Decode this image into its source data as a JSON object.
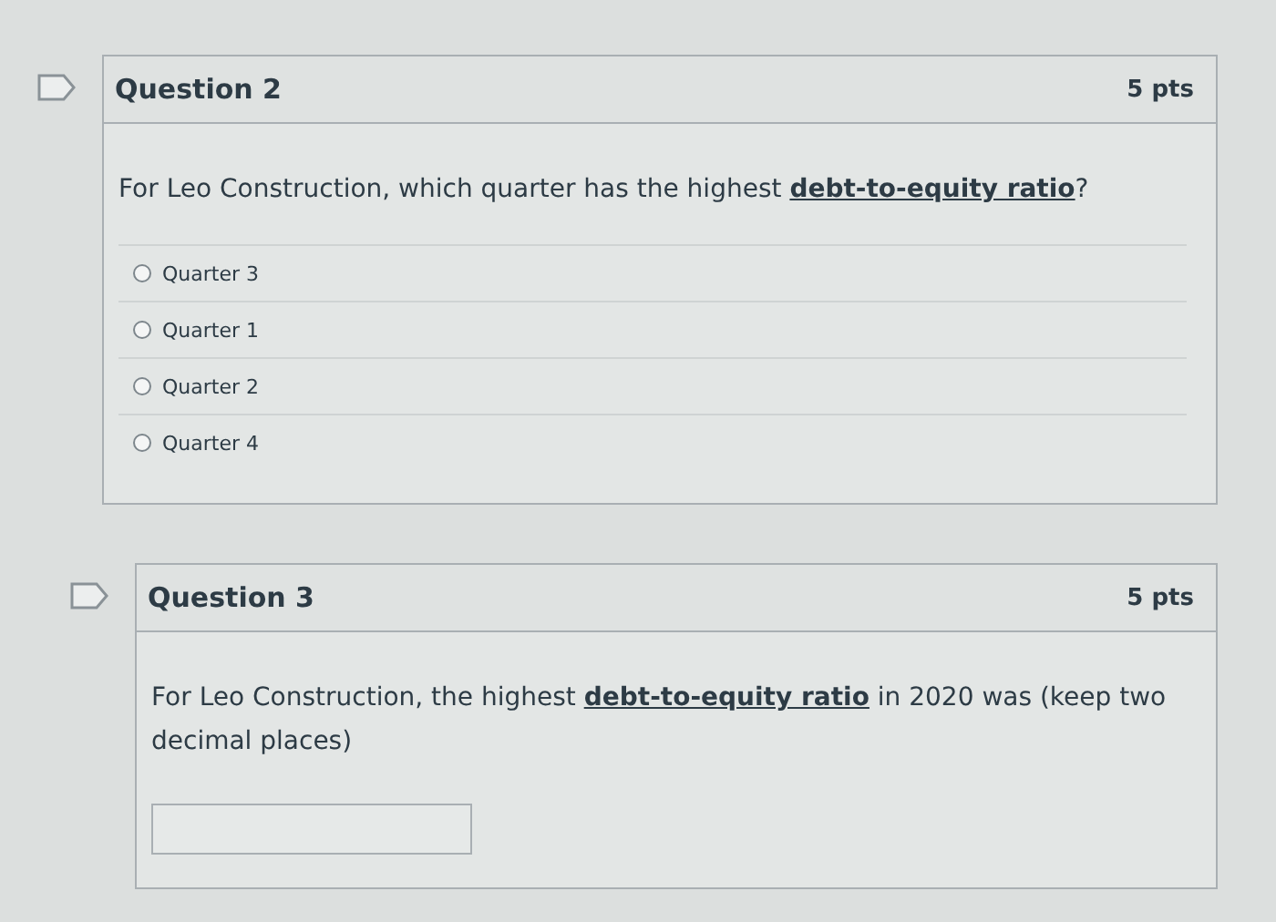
{
  "questions": [
    {
      "kind": "multiple_choice",
      "flagged": false,
      "title": "Question 2",
      "points": "5 pts",
      "prompt": "For Leo Construction, which quarter has the highest **debt-to-equity ratio**?",
      "answers": [
        {
          "label": "Quarter 3",
          "selected": false
        },
        {
          "label": "Quarter 1",
          "selected": false
        },
        {
          "label": "Quarter 2",
          "selected": false
        },
        {
          "label": "Quarter 4",
          "selected": false
        }
      ]
    },
    {
      "kind": "fill_in",
      "flagged": false,
      "title": "Question 3",
      "points": "5 pts",
      "prompt": "For Leo Construction, the highest **debt-to-equity ratio** in 2020 was (keep two decimal places)"
    }
  ]
}
